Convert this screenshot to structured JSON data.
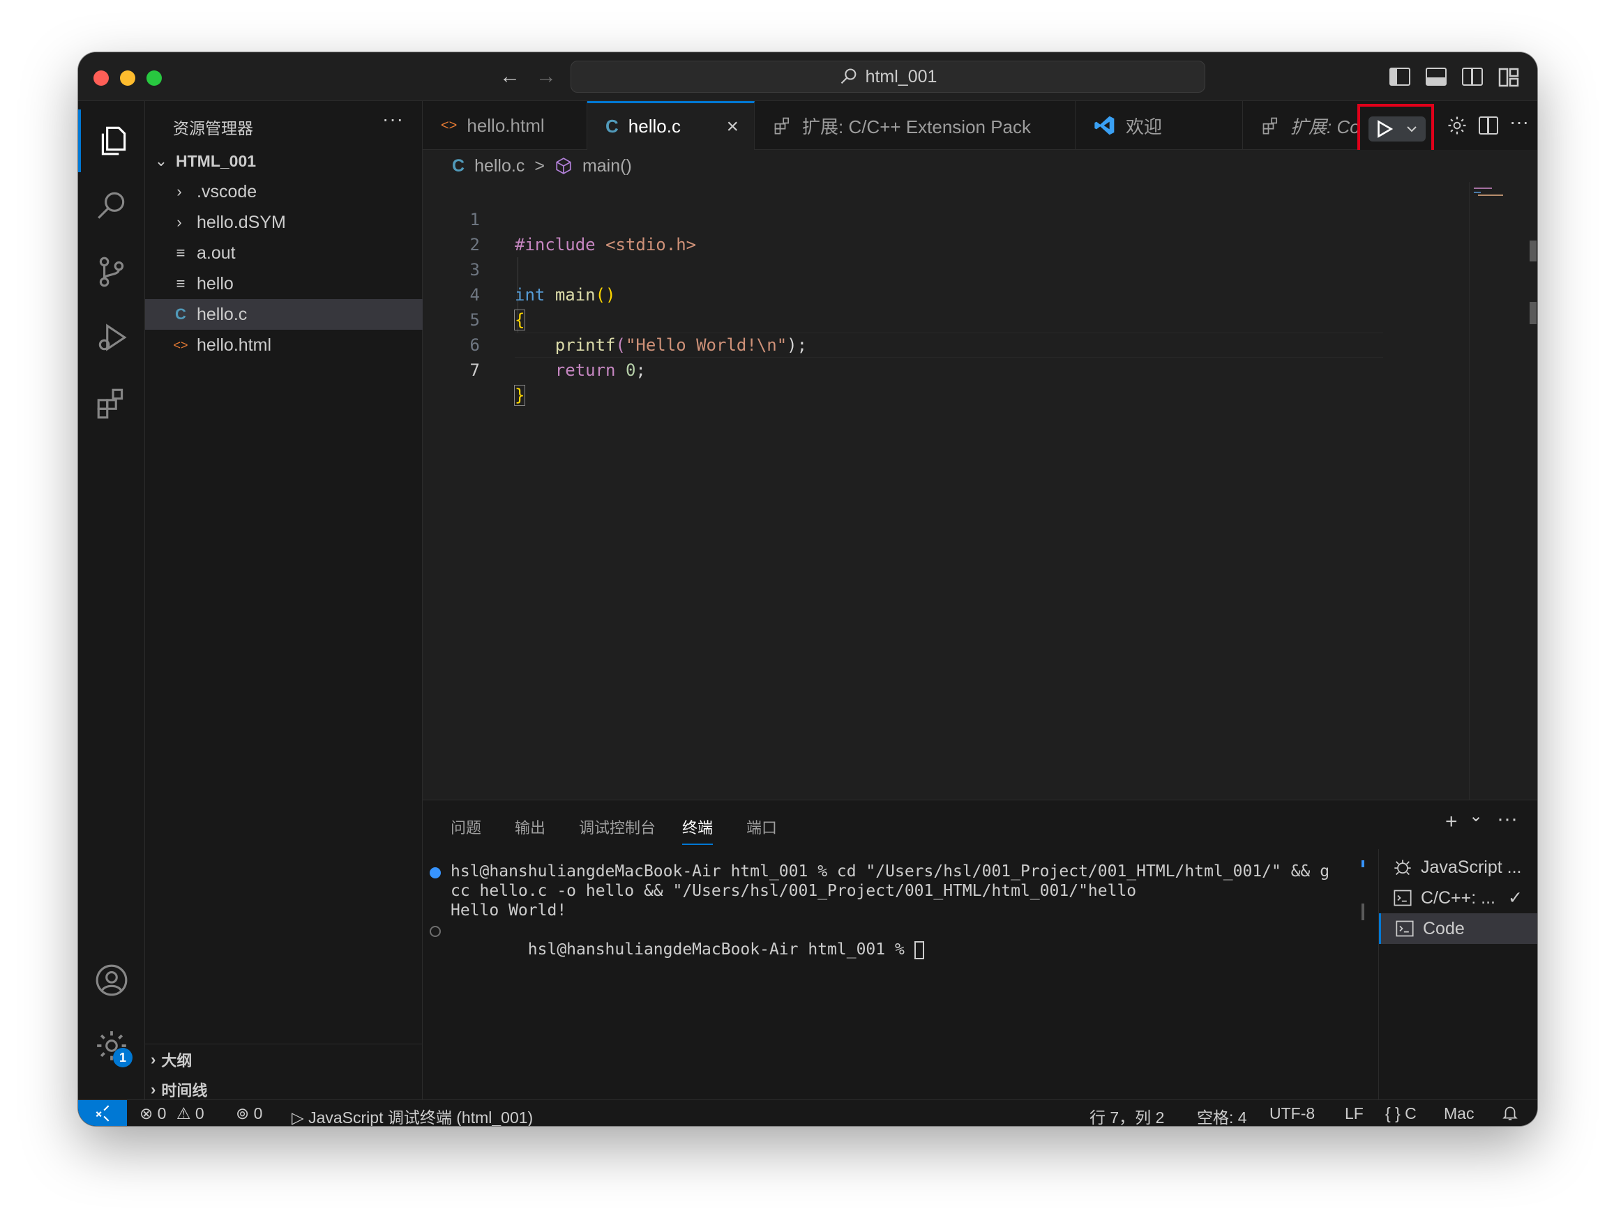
{
  "window": {
    "search_text": "html_001",
    "nav_back": "←",
    "nav_forward": "→"
  },
  "sidebar": {
    "title": "资源管理器",
    "more": "···",
    "root": "HTML_001",
    "items": [
      {
        "label": ".vscode",
        "type": "folder"
      },
      {
        "label": "hello.dSYM",
        "type": "folder"
      },
      {
        "label": "a.out",
        "type": "file"
      },
      {
        "label": "hello",
        "type": "file"
      },
      {
        "label": "hello.c",
        "type": "c",
        "icon": "C"
      },
      {
        "label": "hello.html",
        "type": "html",
        "icon": "<>"
      }
    ],
    "sections": [
      {
        "label": "大纲"
      },
      {
        "label": "时间线"
      }
    ]
  },
  "activity": {
    "settings_badge": "1"
  },
  "tabs": [
    {
      "label": "hello.html",
      "icon": "<>"
    },
    {
      "label": "hello.c",
      "icon": "C",
      "close": "×"
    },
    {
      "label": "扩展: C/C++ Extension Pack"
    },
    {
      "label": "欢迎"
    },
    {
      "label": "扩展: Co"
    }
  ],
  "breadcrumb": {
    "file": "hello.c",
    "separator": ">",
    "symbol": "main()",
    "file_icon": "C"
  },
  "editor": {
    "line_numbers": [
      "1",
      "2",
      "3",
      "4",
      "5",
      "6",
      "7"
    ],
    "code": {
      "l1_pre": "#include ",
      "l1_hdr": "<stdio.h>",
      "l3_type": "int",
      "l3_fn": "main",
      "l3_paren": "()",
      "l4_brace": "{",
      "l5_fn": "printf",
      "l5_open": "(",
      "l5_str": "\"Hello World!\\n\"",
      "l5_close": ");",
      "l6_ret": "return",
      "l6_num": "0",
      "l6_semi": ";",
      "l7_brace": "}"
    }
  },
  "panel": {
    "tabs": [
      "问题",
      "输出",
      "调试控制台",
      "终端",
      "端口"
    ],
    "actions": {
      "add": "+",
      "chev": "⌄",
      "more": "···",
      "up": "⌃",
      "close": "×"
    },
    "terminal": {
      "line1": "hsl@hanshuliangdeMacBook-Air html_001 % cd \"/Users/hsl/001_Project/001_HTML/html_001/\" && g",
      "line2": "cc hello.c -o hello && \"/Users/hsl/001_Project/001_HTML/html_001/\"hello",
      "line3": "Hello World!",
      "line4": "hsl@hanshuliangdeMacBook-Air html_001 % "
    },
    "term_list": [
      {
        "label": "JavaScript ...",
        "icon": "debug-icon"
      },
      {
        "label": "C/C++: ...",
        "icon": "terminal-icon",
        "check": "✓"
      },
      {
        "label": "Code",
        "icon": "terminal-icon"
      }
    ]
  },
  "statusbar": {
    "remote": "⨯",
    "errors": "0",
    "warnings": "0",
    "ports": "0",
    "debug_terminal": "JavaScript 调试终端 (html_001)",
    "position": "行 7，列 2",
    "spaces": "空格: 4",
    "encoding": "UTF-8",
    "eol": "LF",
    "language": "C",
    "lang_icon": "{ }",
    "platform": "Mac"
  },
  "colors": {
    "accent": "#0078d4",
    "highlight_box": "#e0001a"
  }
}
